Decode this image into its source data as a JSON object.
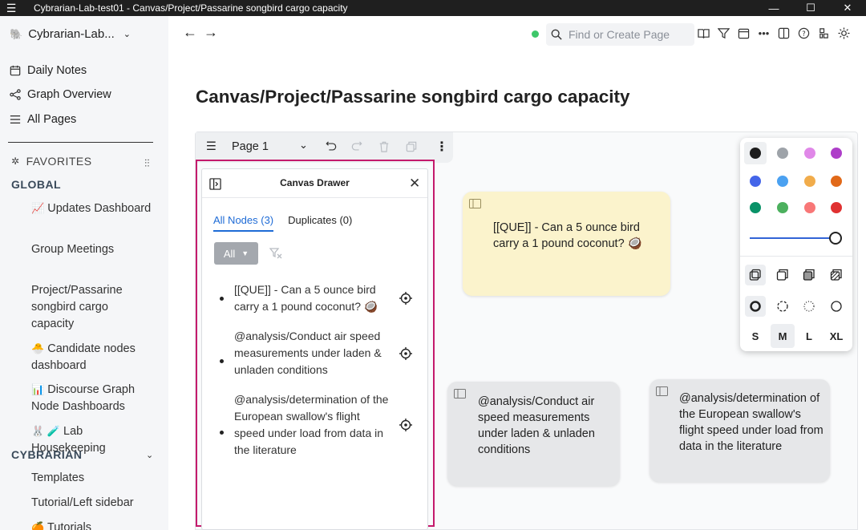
{
  "window": {
    "title": "Cybrarian-Lab-test01 - Canvas/Project/Passarine songbird cargo capacity",
    "menu_icon": "hamburger-icon",
    "controls": [
      "minimize-icon",
      "maximize-icon",
      "close-icon"
    ]
  },
  "sidebar": {
    "graph_name": "Cybrarian-Lab...",
    "nav": [
      {
        "label": "Daily Notes",
        "icon": "calendar-icon"
      },
      {
        "label": "Graph Overview",
        "icon": "graph-icon"
      },
      {
        "label": "All Pages",
        "icon": "list-icon"
      }
    ],
    "favorites_label": "FAVORITES",
    "global_label": "GLOBAL",
    "global_items": [
      {
        "emoji": "📈",
        "label": "Updates Dashboard"
      },
      {
        "emoji": "",
        "label": "Group Meetings"
      },
      {
        "emoji": "",
        "label": "Project/Passarine songbird cargo capacity"
      },
      {
        "emoji": "🐣",
        "label": "Candidate nodes dashboard"
      },
      {
        "emoji": "📊",
        "label": "Discourse Graph Node Dashboards"
      },
      {
        "emoji": "🐰 🧪",
        "label": "Lab Housekeeping"
      }
    ],
    "cybrarian_label": "CYBRARIAN",
    "cybrarian_items": [
      {
        "emoji": "",
        "label": "Templates"
      },
      {
        "emoji": "",
        "label": "Tutorial/Left sidebar"
      },
      {
        "emoji": "🍊",
        "label": "Tutorials"
      }
    ]
  },
  "topbar": {
    "search_placeholder": "Find or Create Page"
  },
  "page": {
    "title": "Canvas/Project/Passarine songbird cargo capacity"
  },
  "canvas_toolbar": {
    "page_label": "Page 1"
  },
  "drawer": {
    "title": "Canvas Drawer",
    "tab_all": "All Nodes (3)",
    "tab_duplicates": "Duplicates (0)",
    "filter_label": "All",
    "nodes": [
      {
        "text": "[[QUE]] - Can a 5 ounce bird carry a 1 pound coconut? 🥥"
      },
      {
        "text": "@analysis/Conduct air speed measurements under laden & unladen conditions"
      },
      {
        "text": "@analysis/determination of the European swallow's flight speed under load from data in the literature"
      }
    ]
  },
  "cards": {
    "que": "[[QUE]] - Can a 5 ounce bird carry a 1 pound coconut? 🥥",
    "analysis1": "@analysis/Conduct air speed measurements under laden & unladen conditions",
    "analysis2": "@analysis/determination of the European swallow's flight speed under load from data in the literature"
  },
  "style_panel": {
    "colors": [
      "#1d1d1d",
      "#9ea3a9",
      "#e088e8",
      "#ae3ec9",
      "#4465e9",
      "#4ba1f1",
      "#f1ac4b",
      "#e16919",
      "#099268",
      "#4cb05e",
      "#f87777",
      "#e03131"
    ],
    "sizes": [
      "S",
      "M",
      "L",
      "XL"
    ],
    "selected_size": "M"
  }
}
